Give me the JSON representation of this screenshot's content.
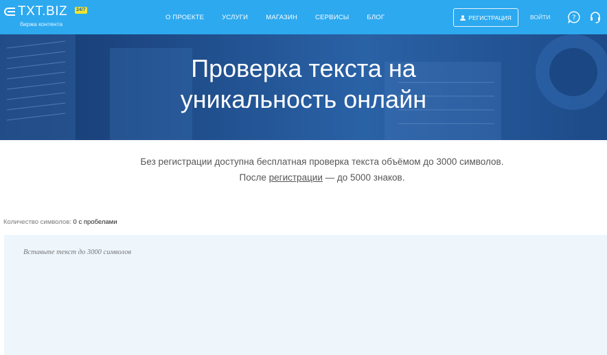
{
  "logo": {
    "text": "TXT.BIZ",
    "badge": "24/7",
    "subtitle": "биржа контента"
  },
  "nav": {
    "items": [
      "О ПРОЕКТЕ",
      "УСЛУГИ",
      "МАГАЗИН",
      "СЕРВИСЫ",
      "БЛОГ"
    ]
  },
  "header": {
    "register_label": "РЕГИСТРАЦИЯ",
    "login_label": "ВОЙТИ"
  },
  "hero": {
    "title_line1": "Проверка текста на",
    "title_line2": "уникальность онлайн"
  },
  "info": {
    "line1": "Без регистрации доступна бесплатная проверка текста объёмом до 3000 символов.",
    "line2_prefix": "После ",
    "line2_link": "регистрации",
    "line2_suffix": " — до 5000 знаков."
  },
  "counter": {
    "label": "Количество символов:",
    "value": "0 с пробелами"
  },
  "editor": {
    "placeholder": "Вставьте текст до 3000 символов",
    "value": ""
  },
  "colors": {
    "header_bg": "#2da9ef",
    "hero_bg": "#1d4a88",
    "editor_bg": "#eef6fc",
    "badge": "#f7e62b"
  }
}
